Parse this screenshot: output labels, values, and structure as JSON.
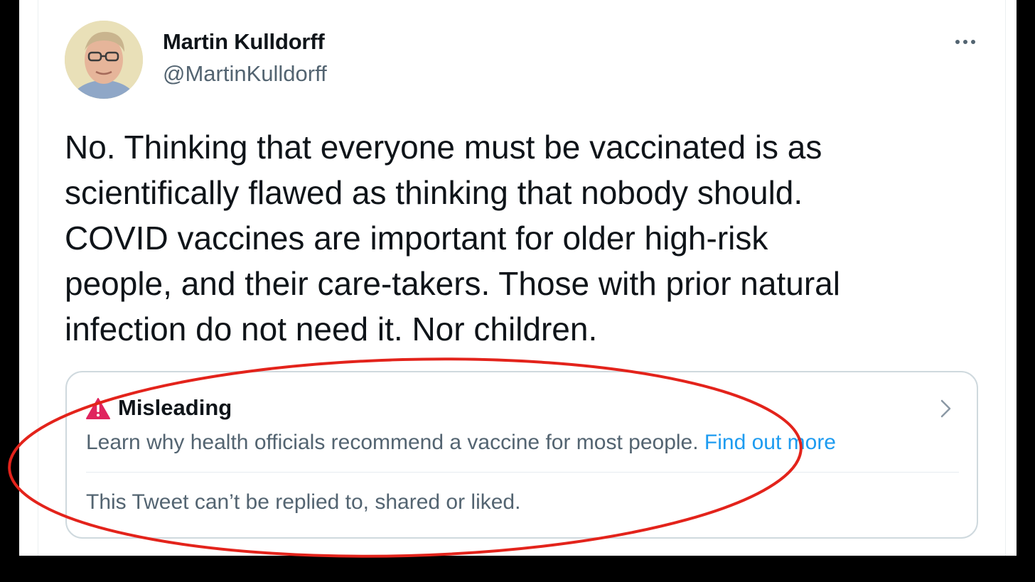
{
  "tweet": {
    "author": {
      "name": "Martin Kulldorff",
      "handle": "@MartinKulldorff",
      "avatar_icon": "profile-photo"
    },
    "text": "No. Thinking that everyone must be vaccinated is as\nscientifically flawed as thinking that nobody should.\nCOVID vaccines are important for older high-risk\npeople, and their care-takers. Those with prior natural\ninfection do not need it. Nor children.",
    "more_icon": "more-horizontal-icon"
  },
  "notice": {
    "label": "Misleading",
    "label_icon": "warning-triangle-icon",
    "message": "Learn why health officials recommend a vaccine for most people.",
    "link_text": "Find out more",
    "restriction": "This Tweet can’t be replied to, shared or liked.",
    "chevron_icon": "chevron-right-icon"
  },
  "colors": {
    "background": "#000000",
    "card": "#ffffff",
    "text_primary": "#0f1419",
    "text_secondary": "#536471",
    "link": "#1d9bf0",
    "warning": "#e0245e",
    "annotation_ellipse": "#e3231b"
  }
}
